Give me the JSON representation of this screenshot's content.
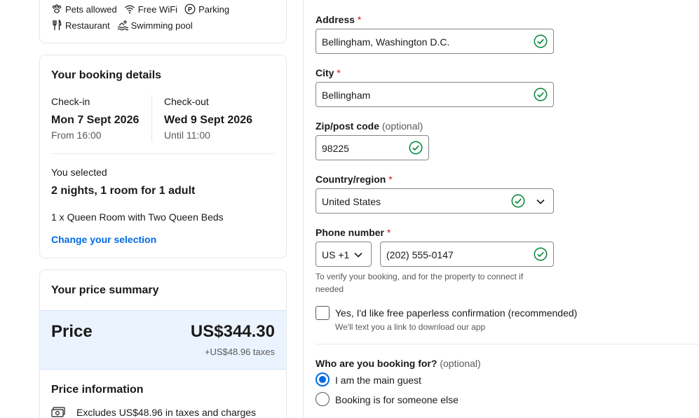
{
  "amenities": {
    "row1": [
      {
        "icon": "paw-icon",
        "label": "Pets allowed"
      },
      {
        "icon": "wifi-icon",
        "label": "Free WiFi"
      },
      {
        "icon": "parking-icon",
        "label": "Parking"
      }
    ],
    "row2": [
      {
        "icon": "restaurant-icon",
        "label": "Restaurant"
      },
      {
        "icon": "swimming-pool-icon",
        "label": "Swimming pool"
      }
    ]
  },
  "booking": {
    "title": "Your booking details",
    "checkin_label": "Check-in",
    "checkin_date": "Mon 7 Sept 2026",
    "checkin_time": "From 16:00",
    "checkout_label": "Check-out",
    "checkout_date": "Wed 9 Sept 2026",
    "checkout_time": "Until 11:00",
    "selected_label": "You selected",
    "selected_summary": "2 nights, 1 room for 1 adult",
    "room": "1 x Queen Room with Two Queen Beds",
    "change_link": "Change your selection"
  },
  "price": {
    "title": "Your price summary",
    "label": "Price",
    "amount": "US$344.30",
    "taxes": "+US$48.96 taxes",
    "info_title": "Price information",
    "info_excludes": "Excludes US$48.96 in taxes and charges"
  },
  "form": {
    "address": {
      "label": "Address",
      "required": "*",
      "value": "Bellingham, Washington D.C."
    },
    "city": {
      "label": "City",
      "required": "*",
      "value": "Bellingham"
    },
    "zip": {
      "label": "Zip/post code",
      "optional": "(optional)",
      "value": "98225"
    },
    "country": {
      "label": "Country/region",
      "required": "*",
      "value": "United States"
    },
    "phone": {
      "label": "Phone number",
      "required": "*",
      "country_code": "US +1",
      "value": "(202) 555-0147"
    },
    "phone_helper": "To verify your booking, and for the property to connect if needed",
    "paperless": {
      "label": "Yes, I'd like free paperless confirmation (recommended)",
      "sub": "We'll text you a link to download our app"
    },
    "booking_for": {
      "label": "Who are you booking for?",
      "optional": "(optional)",
      "options": [
        "I am the main guest",
        "Booking is for someone else"
      ]
    }
  },
  "colors": {
    "accent": "#006ce4",
    "success": "#008234",
    "required": "#d4111e",
    "price_band": "#ebf3ff"
  }
}
